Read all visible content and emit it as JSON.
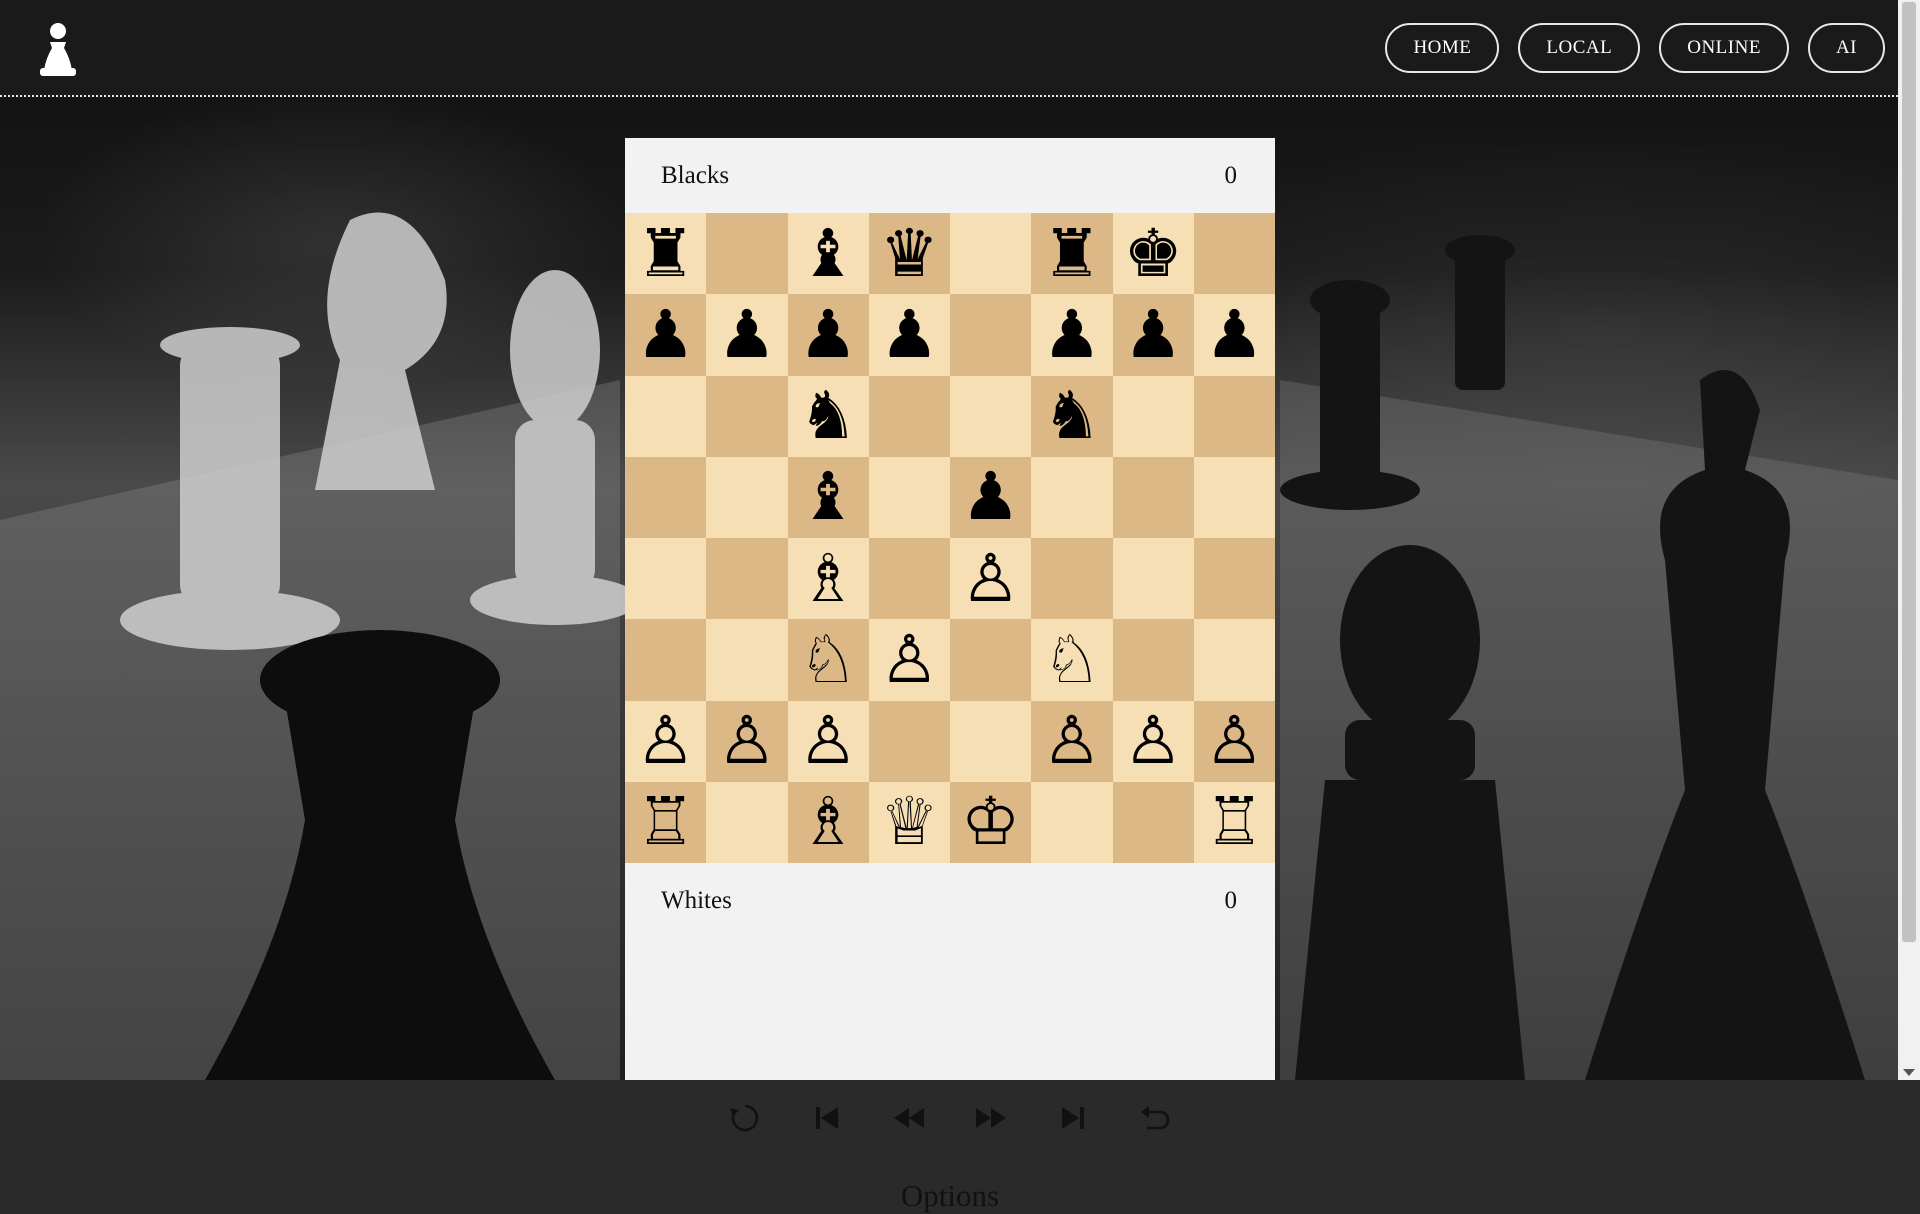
{
  "app": {
    "logo_icon": "pawn-icon"
  },
  "nav": {
    "items": [
      {
        "label": "HOME"
      },
      {
        "label": "LOCAL"
      },
      {
        "label": "ONLINE"
      },
      {
        "label": "AI"
      }
    ]
  },
  "players": {
    "top": {
      "name": "Blacks",
      "score": "0"
    },
    "bottom": {
      "name": "Whites",
      "score": "0"
    }
  },
  "board": {
    "colors": {
      "light": "#f6dfb5",
      "dark": "#ddb887"
    },
    "rows": [
      [
        "♜",
        "",
        "♝",
        "♛",
        "",
        "♜",
        "♚",
        ""
      ],
      [
        "♟",
        "♟",
        "♟",
        "♟",
        "",
        "♟",
        "♟",
        "♟"
      ],
      [
        "",
        "",
        "♞",
        "",
        "",
        "♞",
        "",
        ""
      ],
      [
        "",
        "",
        "♝",
        "",
        "♟",
        "",
        "",
        ""
      ],
      [
        "",
        "",
        "♗",
        "",
        "♙",
        "",
        "",
        ""
      ],
      [
        "",
        "",
        "♘",
        "♙",
        "",
        "♘",
        "",
        ""
      ],
      [
        "♙",
        "♙",
        "♙",
        "",
        "",
        "♙",
        "♙",
        "♙"
      ],
      [
        "♖",
        "",
        "♗",
        "♕",
        "♔",
        "",
        "",
        "♖"
      ]
    ]
  },
  "controls": [
    {
      "icon": "restart-icon"
    },
    {
      "icon": "skip-to-start-icon"
    },
    {
      "icon": "rewind-icon"
    },
    {
      "icon": "fast-forward-icon"
    },
    {
      "icon": "skip-to-end-icon"
    },
    {
      "icon": "undo-icon"
    }
  ],
  "options": {
    "title": "Options"
  }
}
